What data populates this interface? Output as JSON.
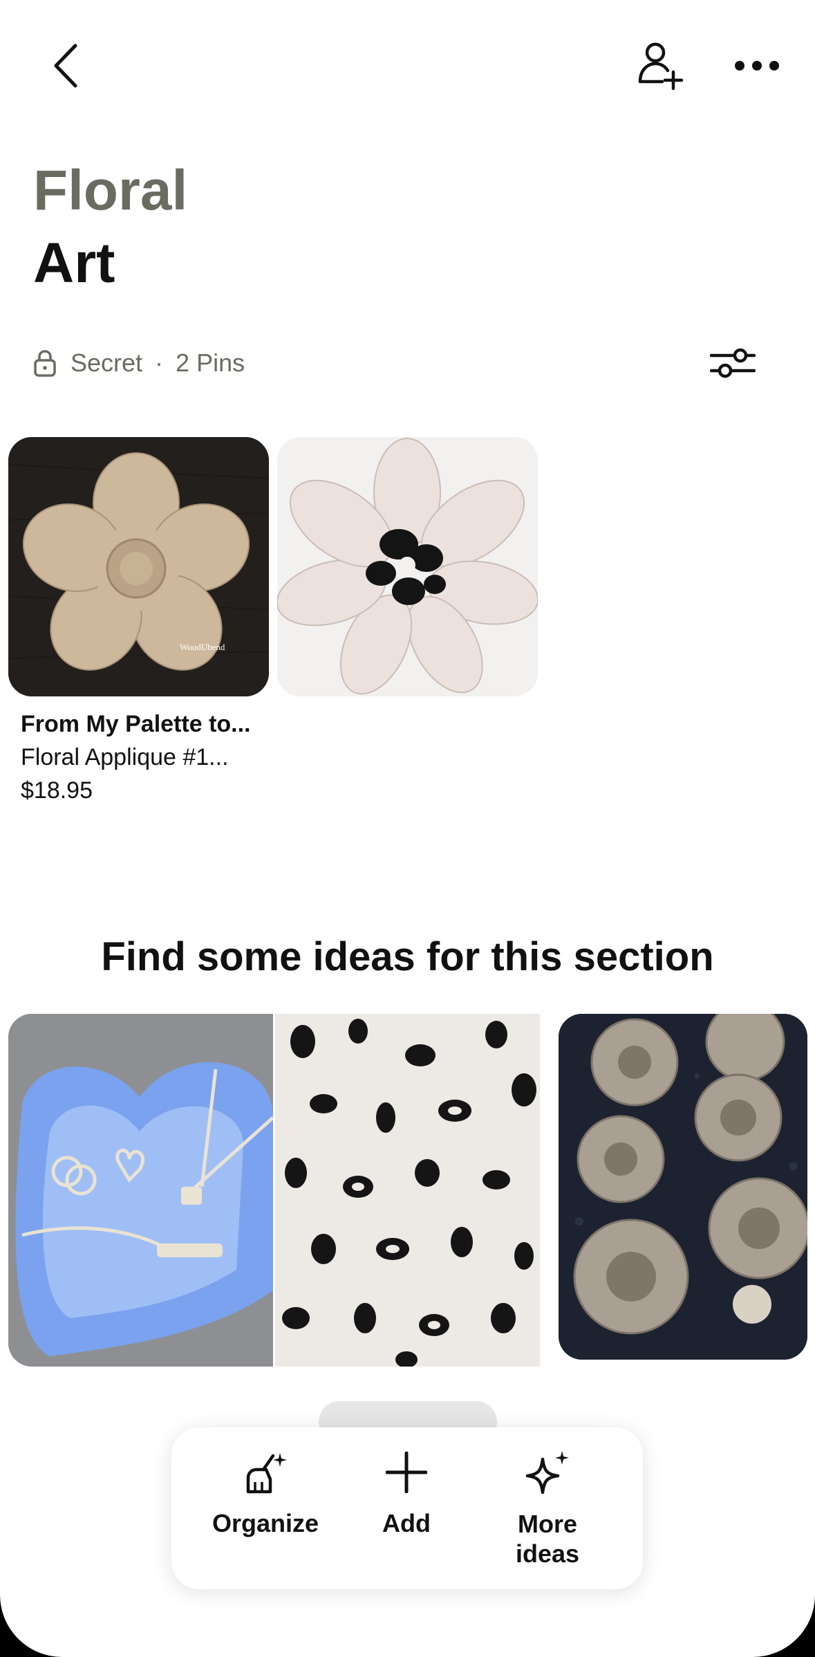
{
  "board": {
    "title_line1": "Floral",
    "title_line2": "Art",
    "visibility": "Secret",
    "separator": "·",
    "pin_count": "2 Pins"
  },
  "pins": [
    {
      "title": "From My Palette to...",
      "subtitle": "Floral Applique #1...",
      "price": "$18.95",
      "image_caption": "WoodUbend"
    }
  ],
  "ideas": {
    "heading": "Find some ideas for this section"
  },
  "actions": {
    "organize": "Organize",
    "add": "Add",
    "more_ideas": "More ideas"
  },
  "icons": {
    "back": "chevron-left-icon",
    "invite": "add-collaborator-icon",
    "more": "more-dots-icon",
    "lock": "lock-icon",
    "filter": "filter-sliders-icon",
    "organize": "broom-sparkle-icon",
    "add": "plus-icon",
    "more_ideas": "sparkle-icon"
  },
  "colors": {
    "title_primary": "#6b6b62",
    "text_dark": "#111111",
    "meta_text": "#6b6b62"
  }
}
